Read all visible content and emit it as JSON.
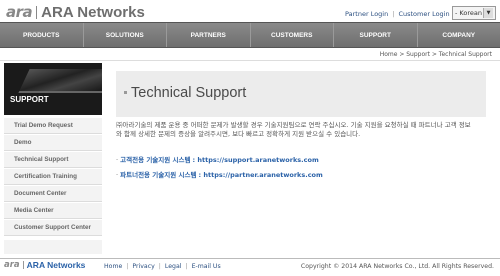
{
  "header": {
    "logo_mark": "ara",
    "logo_name": "ARA Networks",
    "top_links": [
      "Partner Login",
      "|",
      "Customer Login"
    ],
    "language": "- Korean"
  },
  "nav": {
    "items": [
      "PRODUCTS",
      "SOLUTIONS",
      "PARTNERS",
      "CUSTOMERS",
      "SUPPORT",
      "COMPANY"
    ]
  },
  "breadcrumb": "Home > Support > Technical Support",
  "sidebar": {
    "title": "SUPPORT",
    "items": [
      "Trial Demo Request",
      "Demo",
      "Technical Support",
      "Certification Training",
      "Document Center",
      "Media Center",
      "Customer Support Center"
    ]
  },
  "content": {
    "title": "Technical Support",
    "paragraph": "㈜아라기술의 제품 운용 중 어떠한 문제가 발생할 경우 기술지원팀으로 연락 주십시오. 기술 지원을 요청하실 때 파트너나 고객 정보와 함께 상세한 문제의 증상을 알려주시면, 보다 빠르고 정확하게 지원 받으실 수 있습니다.",
    "links": [
      {
        "label": "고객전용 기술지원 시스템",
        "url": "https://support.aranetworks.com"
      },
      {
        "label": "파트너전용 기술지원 시스템",
        "url": "https://partner.aranetworks.com"
      }
    ]
  },
  "footer": {
    "logo_mark": "ara",
    "logo_name": "ARA Networks",
    "links": [
      "Home",
      "Privacy",
      "Legal",
      "E-mail Us"
    ],
    "copyright": "Copyright © 2014 ARA Networks Co., Ltd. All Rights Reserved."
  }
}
